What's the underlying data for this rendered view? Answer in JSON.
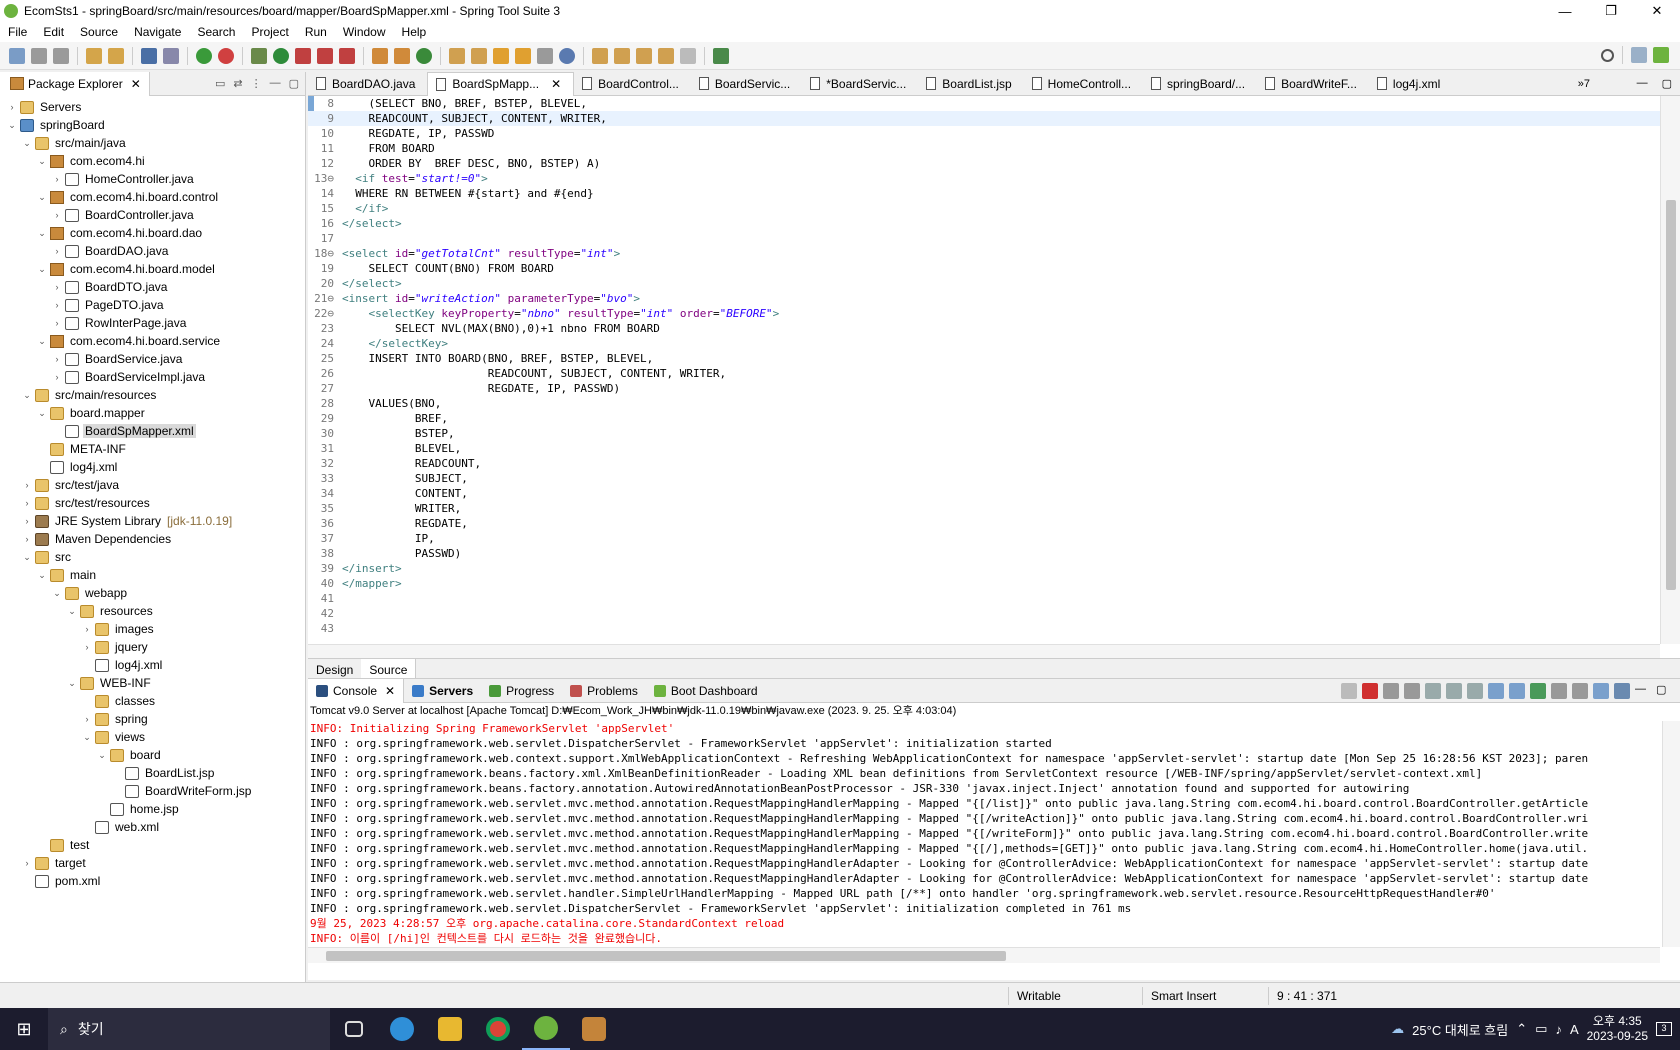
{
  "window": {
    "title": "EcomSts1 - springBoard/src/main/resources/board/mapper/BoardSpMapper.xml - Spring Tool Suite 3",
    "min": "—",
    "max": "❐",
    "close": "✕"
  },
  "menu": [
    "File",
    "Edit",
    "Source",
    "Navigate",
    "Search",
    "Project",
    "Run",
    "Window",
    "Help"
  ],
  "explorer": {
    "tab_label": "Package Explorer",
    "close": "✕",
    "tree": [
      {
        "label": "Servers",
        "depth": 0,
        "twisty": "›",
        "icon": "folder"
      },
      {
        "label": "springBoard",
        "depth": 0,
        "twisty": "⌄",
        "icon": "proj"
      },
      {
        "label": "src/main/java",
        "depth": 1,
        "twisty": "⌄",
        "icon": "folder"
      },
      {
        "label": "com.ecom4.hi",
        "depth": 2,
        "twisty": "⌄",
        "icon": "pkg"
      },
      {
        "label": "HomeController.java",
        "depth": 3,
        "twisty": "›",
        "icon": "java"
      },
      {
        "label": "com.ecom4.hi.board.control",
        "depth": 2,
        "twisty": "⌄",
        "icon": "pkg"
      },
      {
        "label": "BoardController.java",
        "depth": 3,
        "twisty": "›",
        "icon": "java"
      },
      {
        "label": "com.ecom4.hi.board.dao",
        "depth": 2,
        "twisty": "⌄",
        "icon": "pkg"
      },
      {
        "label": "BoardDAO.java",
        "depth": 3,
        "twisty": "›",
        "icon": "java"
      },
      {
        "label": "com.ecom4.hi.board.model",
        "depth": 2,
        "twisty": "⌄",
        "icon": "pkg"
      },
      {
        "label": "BoardDTO.java",
        "depth": 3,
        "twisty": "›",
        "icon": "java"
      },
      {
        "label": "PageDTO.java",
        "depth": 3,
        "twisty": "›",
        "icon": "java"
      },
      {
        "label": "RowInterPage.java",
        "depth": 3,
        "twisty": "›",
        "icon": "java"
      },
      {
        "label": "com.ecom4.hi.board.service",
        "depth": 2,
        "twisty": "⌄",
        "icon": "pkg"
      },
      {
        "label": "BoardService.java",
        "depth": 3,
        "twisty": "›",
        "icon": "java"
      },
      {
        "label": "BoardServiceImpl.java",
        "depth": 3,
        "twisty": "›",
        "icon": "java"
      },
      {
        "label": "src/main/resources",
        "depth": 1,
        "twisty": "⌄",
        "icon": "folder"
      },
      {
        "label": "board.mapper",
        "depth": 2,
        "twisty": "⌄",
        "icon": "folder"
      },
      {
        "label": "BoardSpMapper.xml",
        "depth": 3,
        "twisty": "",
        "icon": "xml",
        "selected": true
      },
      {
        "label": "META-INF",
        "depth": 2,
        "twisty": "",
        "icon": "folder"
      },
      {
        "label": "log4j.xml",
        "depth": 2,
        "twisty": "",
        "icon": "xml"
      },
      {
        "label": "src/test/java",
        "depth": 1,
        "twisty": "›",
        "icon": "folder"
      },
      {
        "label": "src/test/resources",
        "depth": 1,
        "twisty": "›",
        "icon": "folder"
      },
      {
        "label": "JRE System Library",
        "depth": 1,
        "twisty": "›",
        "icon": "lib",
        "decor": "[jdk-11.0.19]"
      },
      {
        "label": "Maven Dependencies",
        "depth": 1,
        "twisty": "›",
        "icon": "lib"
      },
      {
        "label": "src",
        "depth": 1,
        "twisty": "⌄",
        "icon": "folder"
      },
      {
        "label": "main",
        "depth": 2,
        "twisty": "⌄",
        "icon": "folder"
      },
      {
        "label": "webapp",
        "depth": 3,
        "twisty": "⌄",
        "icon": "folder"
      },
      {
        "label": "resources",
        "depth": 4,
        "twisty": "⌄",
        "icon": "folder"
      },
      {
        "label": "images",
        "depth": 5,
        "twisty": "›",
        "icon": "folder"
      },
      {
        "label": "jquery",
        "depth": 5,
        "twisty": "›",
        "icon": "folder"
      },
      {
        "label": "log4j.xml",
        "depth": 5,
        "twisty": "",
        "icon": "xml"
      },
      {
        "label": "WEB-INF",
        "depth": 4,
        "twisty": "⌄",
        "icon": "folder"
      },
      {
        "label": "classes",
        "depth": 5,
        "twisty": "",
        "icon": "folder"
      },
      {
        "label": "spring",
        "depth": 5,
        "twisty": "›",
        "icon": "folder"
      },
      {
        "label": "views",
        "depth": 5,
        "twisty": "⌄",
        "icon": "folder"
      },
      {
        "label": "board",
        "depth": 6,
        "twisty": "⌄",
        "icon": "folder"
      },
      {
        "label": "BoardList.jsp",
        "depth": 7,
        "twisty": "",
        "icon": "jsp"
      },
      {
        "label": "BoardWriteForm.jsp",
        "depth": 7,
        "twisty": "",
        "icon": "jsp"
      },
      {
        "label": "home.jsp",
        "depth": 6,
        "twisty": "",
        "icon": "jsp"
      },
      {
        "label": "web.xml",
        "depth": 5,
        "twisty": "",
        "icon": "xml"
      },
      {
        "label": "test",
        "depth": 2,
        "twisty": "",
        "icon": "folder"
      },
      {
        "label": "target",
        "depth": 1,
        "twisty": "›",
        "icon": "folder"
      },
      {
        "label": "pom.xml",
        "depth": 1,
        "twisty": "",
        "icon": "xml"
      }
    ]
  },
  "editor": {
    "tabs": [
      {
        "label": "BoardDAO.java"
      },
      {
        "label": "BoardSpMapp...",
        "active": true,
        "close": "✕"
      },
      {
        "label": "BoardControl..."
      },
      {
        "label": "BoardServic..."
      },
      {
        "label": "*BoardServic..."
      },
      {
        "label": "BoardList.jsp"
      },
      {
        "label": "HomeControll..."
      },
      {
        "label": "springBoard/..."
      },
      {
        "label": "BoardWriteF..."
      },
      {
        "label": "log4j.xml"
      }
    ],
    "overflow": "»7",
    "bottom_tabs": [
      "Design",
      "Source"
    ],
    "lines": [
      {
        "n": "8",
        "html": "    (SELECT BNO, BREF, BSTEP, BLEVEL,"
      },
      {
        "n": "9",
        "html": "    READCOUNT, SUBJECT, CONTENT, WRITER,",
        "current": true
      },
      {
        "n": "10",
        "html": "    REGDATE, IP, PASSWD"
      },
      {
        "n": "11",
        "html": "    FROM BOARD"
      },
      {
        "n": "12",
        "html": "    ORDER BY  BREF DESC, BNO, BSTEP) A)"
      },
      {
        "n": "13⊖",
        "html": "  <span class='tag'>&lt;if</span> <span class='attr'>test</span>=<span class='val'>\"start!=0\"</span><span class='tag'>&gt;</span>"
      },
      {
        "n": "14",
        "html": "  WHERE RN BETWEEN #{start} and #{end}"
      },
      {
        "n": "15",
        "html": "  <span class='tag'>&lt;/if&gt;</span>"
      },
      {
        "n": "16",
        "html": "<span class='tag'>&lt;/select&gt;</span>"
      },
      {
        "n": "17",
        "html": ""
      },
      {
        "n": "18⊖",
        "html": "<span class='tag'>&lt;select</span> <span class='attr'>id</span>=<span class='val'>\"getTotalCnt\"</span> <span class='attr'>resultType</span>=<span class='val'>\"int\"</span><span class='tag'>&gt;</span>"
      },
      {
        "n": "19",
        "html": "    SELECT COUNT(BNO) FROM BOARD"
      },
      {
        "n": "20",
        "html": "<span class='tag'>&lt;/select&gt;</span>"
      },
      {
        "n": "21⊖",
        "html": "<span class='tag'>&lt;insert</span> <span class='attr'>id</span>=<span class='val'>\"writeAction\"</span> <span class='attr'>parameterType</span>=<span class='val'>\"bvo\"</span><span class='tag'>&gt;</span>"
      },
      {
        "n": "22⊖",
        "html": "    <span class='tag'>&lt;selectKey</span> <span class='attr'>keyProperty</span>=<span class='val'>\"nbno\"</span> <span class='attr'>resultType</span>=<span class='val'>\"int\"</span> <span class='attr'>order</span>=<span class='val'>\"BEFORE\"</span><span class='tag'>&gt;</span>"
      },
      {
        "n": "23",
        "html": "        SELECT NVL(MAX(BNO),0)+1 nbno FROM BOARD"
      },
      {
        "n": "24",
        "html": "    <span class='tag'>&lt;/selectKey&gt;</span>"
      },
      {
        "n": "25",
        "html": "    INSERT INTO BOARD(BNO, BREF, BSTEP, BLEVEL,"
      },
      {
        "n": "26",
        "html": "                      READCOUNT, SUBJECT, CONTENT, WRITER,"
      },
      {
        "n": "27",
        "html": "                      REGDATE, IP, PASSWD)"
      },
      {
        "n": "28",
        "html": "    VALUES(BNO,"
      },
      {
        "n": "29",
        "html": "           BREF,"
      },
      {
        "n": "30",
        "html": "           BSTEP,"
      },
      {
        "n": "31",
        "html": "           BLEVEL,"
      },
      {
        "n": "32",
        "html": "           READCOUNT,"
      },
      {
        "n": "33",
        "html": "           SUBJECT,"
      },
      {
        "n": "34",
        "html": "           CONTENT,"
      },
      {
        "n": "35",
        "html": "           WRITER,"
      },
      {
        "n": "36",
        "html": "           REGDATE,"
      },
      {
        "n": "37",
        "html": "           IP,"
      },
      {
        "n": "38",
        "html": "           PASSWD)"
      },
      {
        "n": "39",
        "html": "<span class='tag'>&lt;/insert&gt;</span>"
      },
      {
        "n": "40",
        "html": "<span class='tag'>&lt;/mapper&gt;</span>"
      },
      {
        "n": "41",
        "html": ""
      },
      {
        "n": "42",
        "html": ""
      },
      {
        "n": "43",
        "html": ""
      }
    ]
  },
  "console": {
    "tabs": [
      {
        "label": "Console",
        "active": true,
        "close": "✕",
        "color": "#2b4f7f"
      },
      {
        "label": "Servers",
        "bold": true,
        "color": "#3a7bc8"
      },
      {
        "label": "Progress",
        "color": "#4a9a3a"
      },
      {
        "label": "Problems",
        "color": "#c0504d"
      },
      {
        "label": "Boot Dashboard",
        "color": "#6db33f"
      }
    ],
    "description": "Tomcat v9.0 Server at localhost [Apache Tomcat] D:₩Ecom_Work_JH₩bin₩jdk-11.0.19₩bin₩javaw.exe  (2023. 9. 25. 오후 4:03:04)",
    "lines": [
      {
        "text": "INFO: Initializing Spring FrameworkServlet 'appServlet'",
        "red": true
      },
      {
        "text": "INFO : org.springframework.web.servlet.DispatcherServlet - FrameworkServlet 'appServlet': initialization started"
      },
      {
        "text": "INFO : org.springframework.web.context.support.XmlWebApplicationContext - Refreshing WebApplicationContext for namespace 'appServlet-servlet': startup date [Mon Sep 25 16:28:56 KST 2023]; paren"
      },
      {
        "text": "INFO : org.springframework.beans.factory.xml.XmlBeanDefinitionReader - Loading XML bean definitions from ServletContext resource [/WEB-INF/spring/appServlet/servlet-context.xml]"
      },
      {
        "text": "INFO : org.springframework.beans.factory.annotation.AutowiredAnnotationBeanPostProcessor - JSR-330 'javax.inject.Inject' annotation found and supported for autowiring"
      },
      {
        "text": "INFO : org.springframework.web.servlet.mvc.method.annotation.RequestMappingHandlerMapping - Mapped \"{[/list]}\" onto public java.lang.String com.ecom4.hi.board.control.BoardController.getArticle"
      },
      {
        "text": "INFO : org.springframework.web.servlet.mvc.method.annotation.RequestMappingHandlerMapping - Mapped \"{[/writeAction]}\" onto public java.lang.String com.ecom4.hi.board.control.BoardController.wri"
      },
      {
        "text": "INFO : org.springframework.web.servlet.mvc.method.annotation.RequestMappingHandlerMapping - Mapped \"{[/writeForm]}\" onto public java.lang.String com.ecom4.hi.board.control.BoardController.write"
      },
      {
        "text": "INFO : org.springframework.web.servlet.mvc.method.annotation.RequestMappingHandlerMapping - Mapped \"{[/],methods=[GET]}\" onto public java.lang.String com.ecom4.hi.HomeController.home(java.util."
      },
      {
        "text": "INFO : org.springframework.web.servlet.mvc.method.annotation.RequestMappingHandlerAdapter - Looking for @ControllerAdvice: WebApplicationContext for namespace 'appServlet-servlet': startup date"
      },
      {
        "text": "INFO : org.springframework.web.servlet.mvc.method.annotation.RequestMappingHandlerAdapter - Looking for @ControllerAdvice: WebApplicationContext for namespace 'appServlet-servlet': startup date"
      },
      {
        "text": "INFO : org.springframework.web.servlet.handler.SimpleUrlHandlerMapping - Mapped URL path [/**] onto handler 'org.springframework.web.servlet.resource.ResourceHttpRequestHandler#0'"
      },
      {
        "text": "INFO : org.springframework.web.servlet.DispatcherServlet - FrameworkServlet 'appServlet': initialization completed in 761 ms"
      },
      {
        "text": "9월 25, 2023 4:28:57 오후 org.apache.catalina.core.StandardContext reload",
        "red": true
      },
      {
        "text": "INFO: 이름이 [/hi]인 컨텍스트를 다시 로드하는 것을 완료했습니다.",
        "red": true
      }
    ]
  },
  "status": {
    "writable": "Writable",
    "insert_mode": "Smart Insert",
    "position": "9 : 41 : 371"
  },
  "taskbar": {
    "search_placeholder": "찾기",
    "weather": "25°C  대체로 흐림",
    "time": "오후 4:35",
    "date": "2023-09-25",
    "notifications": "3",
    "ime": "A"
  },
  "colors": {
    "accent": "#6db33f",
    "error_red": "#e00000"
  }
}
